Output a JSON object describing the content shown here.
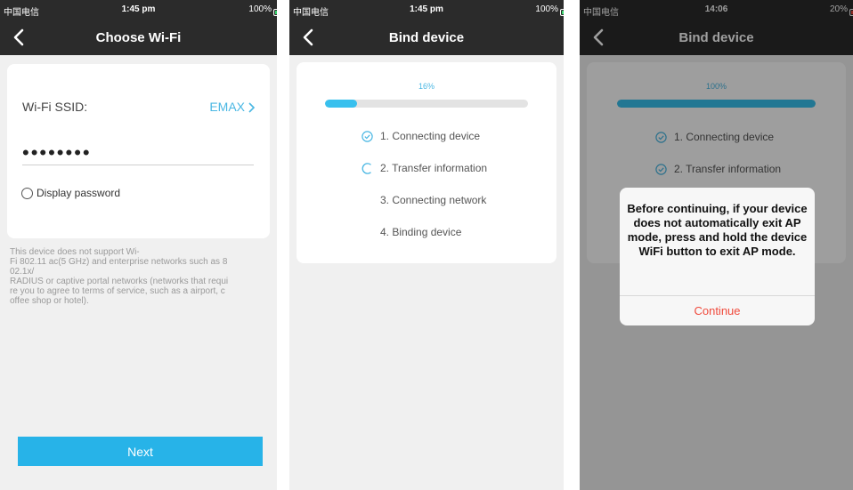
{
  "colors": {
    "accent": "#27b3e8",
    "nav_bg": "#2b2b2b",
    "page_bg": "#f0f0f0",
    "alert": "#f04a3c"
  },
  "screen1": {
    "status": {
      "carrier": "中国电信",
      "time": "1:45 pm",
      "battery": "100%"
    },
    "title": "Choose Wi-Fi",
    "ssid_label": "Wi-Fi SSID:",
    "ssid_value": "EMAX",
    "password_masked": "••••••••",
    "display_password": "Display password",
    "hint": "This device does not support Wi-\nFi 802.11 ac(5 GHz) and enterprise networks such as 8\n02.1x/\nRADIUS or captive portal networks (networks that requi\nre you to agree to terms of service, such as a airport, c\noffee shop or hotel).",
    "next": "Next"
  },
  "screen2": {
    "status": {
      "carrier": "中国电信",
      "time": "1:45 pm",
      "battery": "100%"
    },
    "title": "Bind device",
    "progress_label": "16%",
    "progress": 0.16,
    "steps": [
      {
        "label": "1. Connecting device",
        "state": "done"
      },
      {
        "label": "2. Transfer information",
        "state": "loading"
      },
      {
        "label": "3. Connecting network",
        "state": "pending"
      },
      {
        "label": "4. Binding device",
        "state": "pending"
      }
    ]
  },
  "screen3": {
    "status": {
      "carrier": "中国电信",
      "time": "14:06",
      "battery": "20%"
    },
    "title": "Bind device",
    "progress_label": "100%",
    "progress": 1.0,
    "steps": [
      {
        "label": "1. Connecting device",
        "state": "done"
      },
      {
        "label": "2. Transfer information",
        "state": "done"
      }
    ],
    "dialog": {
      "message": "Before continuing, if your device does not automatically exit AP mode, press and hold the device WiFi button to exit AP mode.",
      "button": "Continue"
    }
  }
}
